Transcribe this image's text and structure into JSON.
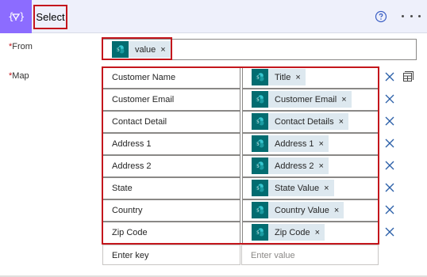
{
  "header": {
    "title": "Select",
    "accent_color": "#8c6cff",
    "icon": "select-data-operation-icon",
    "help_icon": "help-circle-icon",
    "more_icon": "ellipsis-icon"
  },
  "from": {
    "label": "From",
    "required_mark": "*",
    "token": {
      "label": "value",
      "icon": "sharepoint-icon",
      "remove": "×"
    }
  },
  "map": {
    "label": "Map",
    "required_mark": "*",
    "rows": [
      {
        "key": "Customer Name",
        "value": "Title"
      },
      {
        "key": "Customer Email",
        "value": "Customer Email"
      },
      {
        "key": "Contact Detail",
        "value": "Contact Details"
      },
      {
        "key": "Address 1",
        "value": "Address 1"
      },
      {
        "key": "Address 2",
        "value": "Address 2"
      },
      {
        "key": "State",
        "value": "State Value"
      },
      {
        "key": "Country",
        "value": "Country Value"
      },
      {
        "key": "Zip Code",
        "value": "Zip Code"
      }
    ],
    "token_remove": "×",
    "key_placeholder": "Enter key",
    "value_placeholder": "Enter value",
    "switch_mode_icon": "text-mode-icon",
    "delete_icon": "close-icon"
  },
  "colors": {
    "highlight": "#c4161c",
    "token_bg": "#dde8ef",
    "sharepoint": "#036c70",
    "delete_x": "#2b5fa8"
  }
}
